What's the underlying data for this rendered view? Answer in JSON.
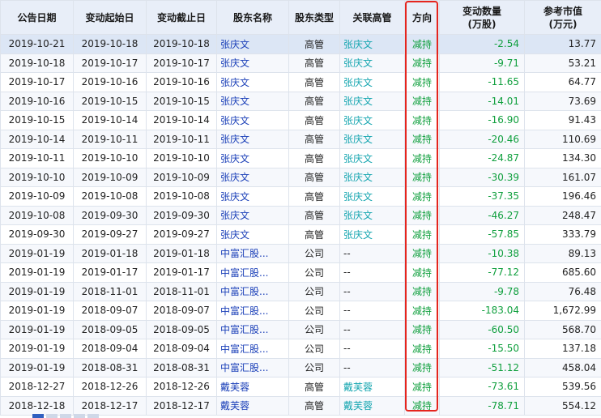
{
  "headers": {
    "announce_date": "公告日期",
    "start_date": "变动起始日",
    "end_date": "变动截止日",
    "holder_name": "股东名称",
    "holder_type": "股东类型",
    "related_exec": "关联高管",
    "direction": "方向",
    "change_qty": "变动数量",
    "change_qty_unit": "(万股)",
    "ref_value": "参考市值",
    "ref_value_unit": "(万元)"
  },
  "rows": [
    [
      "2019-10-21",
      "2019-10-18",
      "2019-10-18",
      "张庆文",
      "高管",
      "张庆文",
      "减持",
      "-2.54",
      "13.77"
    ],
    [
      "2019-10-18",
      "2019-10-17",
      "2019-10-17",
      "张庆文",
      "高管",
      "张庆文",
      "减持",
      "-9.71",
      "53.21"
    ],
    [
      "2019-10-17",
      "2019-10-16",
      "2019-10-16",
      "张庆文",
      "高管",
      "张庆文",
      "减持",
      "-11.65",
      "64.77"
    ],
    [
      "2019-10-16",
      "2019-10-15",
      "2019-10-15",
      "张庆文",
      "高管",
      "张庆文",
      "减持",
      "-14.01",
      "73.69"
    ],
    [
      "2019-10-15",
      "2019-10-14",
      "2019-10-14",
      "张庆文",
      "高管",
      "张庆文",
      "减持",
      "-16.90",
      "91.43"
    ],
    [
      "2019-10-14",
      "2019-10-11",
      "2019-10-11",
      "张庆文",
      "高管",
      "张庆文",
      "减持",
      "-20.46",
      "110.69"
    ],
    [
      "2019-10-11",
      "2019-10-10",
      "2019-10-10",
      "张庆文",
      "高管",
      "张庆文",
      "减持",
      "-24.87",
      "134.30"
    ],
    [
      "2019-10-10",
      "2019-10-09",
      "2019-10-09",
      "张庆文",
      "高管",
      "张庆文",
      "减持",
      "-30.39",
      "161.07"
    ],
    [
      "2019-10-09",
      "2019-10-08",
      "2019-10-08",
      "张庆文",
      "高管",
      "张庆文",
      "减持",
      "-37.35",
      "196.46"
    ],
    [
      "2019-10-08",
      "2019-09-30",
      "2019-09-30",
      "张庆文",
      "高管",
      "张庆文",
      "减持",
      "-46.27",
      "248.47"
    ],
    [
      "2019-09-30",
      "2019-09-27",
      "2019-09-27",
      "张庆文",
      "高管",
      "张庆文",
      "减持",
      "-57.85",
      "333.79"
    ],
    [
      "2019-01-19",
      "2019-01-18",
      "2019-01-18",
      "中富汇股...",
      "公司",
      "--",
      "减持",
      "-10.38",
      "89.13"
    ],
    [
      "2019-01-19",
      "2019-01-17",
      "2019-01-17",
      "中富汇股...",
      "公司",
      "--",
      "减持",
      "-77.12",
      "685.60"
    ],
    [
      "2019-01-19",
      "2018-11-01",
      "2018-11-01",
      "中富汇股...",
      "公司",
      "--",
      "减持",
      "-9.78",
      "76.48"
    ],
    [
      "2019-01-19",
      "2018-09-07",
      "2018-09-07",
      "中富汇股...",
      "公司",
      "--",
      "减持",
      "-183.04",
      "1,672.99"
    ],
    [
      "2019-01-19",
      "2018-09-05",
      "2018-09-05",
      "中富汇股...",
      "公司",
      "--",
      "减持",
      "-60.50",
      "568.70"
    ],
    [
      "2019-01-19",
      "2018-09-04",
      "2018-09-04",
      "中富汇股...",
      "公司",
      "--",
      "减持",
      "-15.50",
      "137.18"
    ],
    [
      "2019-01-19",
      "2018-08-31",
      "2018-08-31",
      "中富汇股...",
      "公司",
      "--",
      "减持",
      "-51.12",
      "458.04"
    ],
    [
      "2018-12-27",
      "2018-12-26",
      "2018-12-26",
      "戴芙蓉",
      "高管",
      "戴芙蓉",
      "减持",
      "-73.61",
      "539.56"
    ],
    [
      "2018-12-18",
      "2018-12-17",
      "2018-12-17",
      "戴芙蓉",
      "高管",
      "戴芙蓉",
      "减持",
      "-78.71",
      "554.12"
    ]
  ],
  "colors": {
    "header_bg": "#e8eef8",
    "name_link": "#1a3fb8",
    "exec_link": "#16a6b0",
    "decrease_green": "#0f9f3d",
    "highlight_red": "#e5251e"
  }
}
